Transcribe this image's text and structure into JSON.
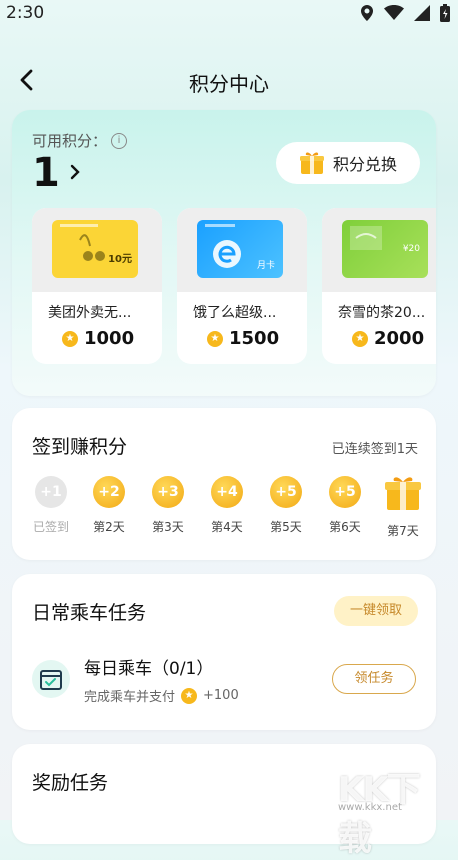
{
  "status_bar": {
    "time": "2:30"
  },
  "header": {
    "title": "积分中心"
  },
  "points": {
    "label": "可用积分：",
    "value": "1",
    "exchange_label": "积分兑换"
  },
  "rewards": [
    {
      "name": "美团外卖无...",
      "cost": "1000",
      "card_text": "10元"
    },
    {
      "name": "饿了么超级...",
      "cost": "1500",
      "card_text": "月卡"
    },
    {
      "name": "奈雪的茶20...",
      "cost": "2000",
      "card_text": "¥20"
    }
  ],
  "checkin": {
    "title": "签到赚积分",
    "status": "已连续签到1天",
    "days": [
      {
        "badge": "+1",
        "label": "已签到",
        "done": true
      },
      {
        "badge": "+2",
        "label": "第2天",
        "done": false
      },
      {
        "badge": "+3",
        "label": "第3天",
        "done": false
      },
      {
        "badge": "+4",
        "label": "第4天",
        "done": false
      },
      {
        "badge": "+5",
        "label": "第5天",
        "done": false
      },
      {
        "badge": "+5",
        "label": "第6天",
        "done": false
      },
      {
        "badge": "",
        "label": "第7天",
        "done": false
      }
    ]
  },
  "ride_tasks": {
    "title": "日常乘车任务",
    "oneclick_label": "一键领取",
    "task": {
      "title": "每日乘车（0/1）",
      "desc": "完成乘车并支付",
      "reward": "+100",
      "button": "领任务"
    }
  },
  "bonus_tasks": {
    "title": "奖励任务"
  },
  "watermark": {
    "text": "KK下载",
    "url": "www.kkx.net"
  },
  "colors": {
    "accent": "#34d2b0",
    "coin": "#f7b81c",
    "button_gold": "#c6892b"
  }
}
